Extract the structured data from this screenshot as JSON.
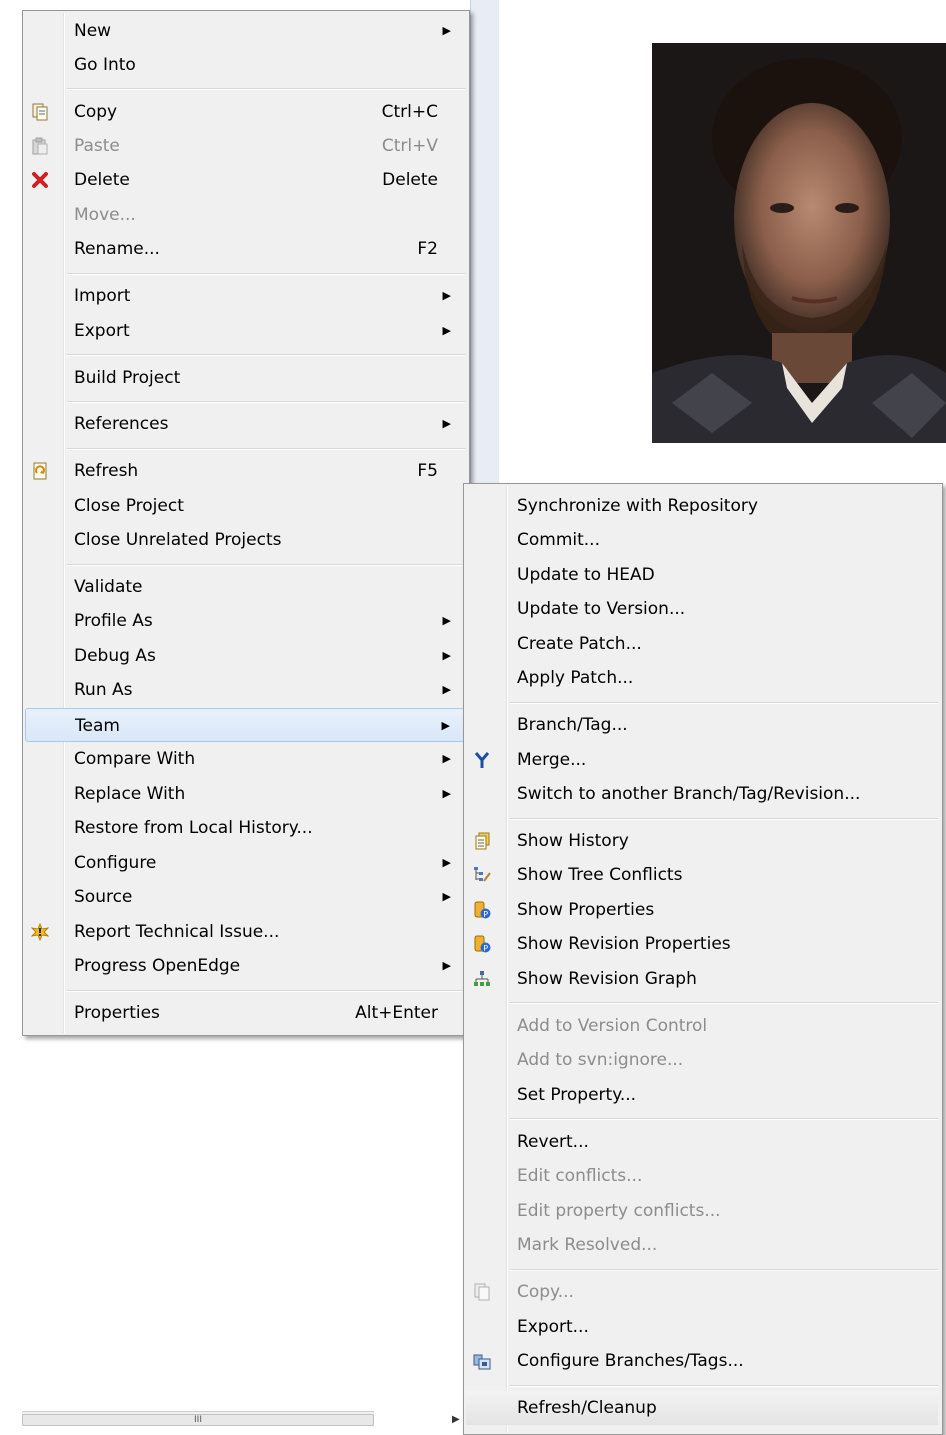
{
  "main_menu": {
    "items": [
      {
        "label": "New",
        "shortcut": "",
        "submenu": true,
        "disabled": false,
        "icon": ""
      },
      {
        "label": "Go Into",
        "shortcut": "",
        "submenu": false,
        "disabled": false,
        "icon": ""
      },
      {
        "label": "Copy",
        "shortcut": "Ctrl+C",
        "submenu": false,
        "disabled": false,
        "icon": "copy-icon"
      },
      {
        "label": "Paste",
        "shortcut": "Ctrl+V",
        "submenu": false,
        "disabled": true,
        "icon": "paste-icon"
      },
      {
        "label": "Delete",
        "shortcut": "Delete",
        "submenu": false,
        "disabled": false,
        "icon": "delete-icon"
      },
      {
        "label": "Move...",
        "shortcut": "",
        "submenu": false,
        "disabled": true,
        "icon": ""
      },
      {
        "label": "Rename...",
        "shortcut": "F2",
        "submenu": false,
        "disabled": false,
        "icon": ""
      },
      {
        "label": "Import",
        "shortcut": "",
        "submenu": true,
        "disabled": false,
        "icon": ""
      },
      {
        "label": "Export",
        "shortcut": "",
        "submenu": true,
        "disabled": false,
        "icon": ""
      },
      {
        "label": "Build Project",
        "shortcut": "",
        "submenu": false,
        "disabled": false,
        "icon": ""
      },
      {
        "label": "References",
        "shortcut": "",
        "submenu": true,
        "disabled": false,
        "icon": ""
      },
      {
        "label": "Refresh",
        "shortcut": "F5",
        "submenu": false,
        "disabled": false,
        "icon": "refresh-icon"
      },
      {
        "label": "Close Project",
        "shortcut": "",
        "submenu": false,
        "disabled": false,
        "icon": ""
      },
      {
        "label": "Close Unrelated Projects",
        "shortcut": "",
        "submenu": false,
        "disabled": false,
        "icon": ""
      },
      {
        "label": "Validate",
        "shortcut": "",
        "submenu": false,
        "disabled": false,
        "icon": ""
      },
      {
        "label": "Profile As",
        "shortcut": "",
        "submenu": true,
        "disabled": false,
        "icon": ""
      },
      {
        "label": "Debug As",
        "shortcut": "",
        "submenu": true,
        "disabled": false,
        "icon": ""
      },
      {
        "label": "Run As",
        "shortcut": "",
        "submenu": true,
        "disabled": false,
        "icon": ""
      },
      {
        "label": "Team",
        "shortcut": "",
        "submenu": true,
        "disabled": false,
        "icon": "",
        "selected": true
      },
      {
        "label": "Compare With",
        "shortcut": "",
        "submenu": true,
        "disabled": false,
        "icon": ""
      },
      {
        "label": "Replace With",
        "shortcut": "",
        "submenu": true,
        "disabled": false,
        "icon": ""
      },
      {
        "label": "Restore from Local History...",
        "shortcut": "",
        "submenu": false,
        "disabled": false,
        "icon": ""
      },
      {
        "label": "Configure",
        "shortcut": "",
        "submenu": true,
        "disabled": false,
        "icon": ""
      },
      {
        "label": "Source",
        "shortcut": "",
        "submenu": true,
        "disabled": false,
        "icon": ""
      },
      {
        "label": "Report Technical Issue...",
        "shortcut": "",
        "submenu": false,
        "disabled": false,
        "icon": "report-issue-icon"
      },
      {
        "label": "Progress OpenEdge",
        "shortcut": "",
        "submenu": true,
        "disabled": false,
        "icon": ""
      },
      {
        "label": "Properties",
        "shortcut": "Alt+Enter",
        "submenu": false,
        "disabled": false,
        "icon": ""
      }
    ],
    "submenu_arrow": "▶"
  },
  "team_menu": {
    "items": [
      {
        "label": "Synchronize with Repository",
        "disabled": false,
        "icon": ""
      },
      {
        "label": "Commit...",
        "disabled": false,
        "icon": ""
      },
      {
        "label": "Update to HEAD",
        "disabled": false,
        "icon": ""
      },
      {
        "label": "Update to Version...",
        "disabled": false,
        "icon": ""
      },
      {
        "label": "Create Patch...",
        "disabled": false,
        "icon": ""
      },
      {
        "label": "Apply Patch...",
        "disabled": false,
        "icon": ""
      },
      {
        "label": "Branch/Tag...",
        "disabled": false,
        "icon": ""
      },
      {
        "label": "Merge...",
        "disabled": false,
        "icon": "merge-icon"
      },
      {
        "label": "Switch to another Branch/Tag/Revision...",
        "disabled": false,
        "icon": ""
      },
      {
        "label": "Show History",
        "disabled": false,
        "icon": "history-icon"
      },
      {
        "label": "Show Tree Conflicts",
        "disabled": false,
        "icon": "tree-conflicts-icon"
      },
      {
        "label": "Show Properties",
        "disabled": false,
        "icon": "properties-icon"
      },
      {
        "label": "Show Revision Properties",
        "disabled": false,
        "icon": "revision-properties-icon"
      },
      {
        "label": "Show Revision Graph",
        "disabled": false,
        "icon": "revision-graph-icon"
      },
      {
        "label": "Add to Version Control",
        "disabled": true,
        "icon": ""
      },
      {
        "label": "Add to svn:ignore...",
        "disabled": true,
        "icon": ""
      },
      {
        "label": "Set Property...",
        "disabled": false,
        "icon": ""
      },
      {
        "label": "Revert...",
        "disabled": false,
        "icon": ""
      },
      {
        "label": "Edit conflicts...",
        "disabled": true,
        "icon": ""
      },
      {
        "label": "Edit property conflicts...",
        "disabled": true,
        "icon": ""
      },
      {
        "label": "Mark Resolved...",
        "disabled": true,
        "icon": ""
      },
      {
        "label": "Copy...",
        "disabled": true,
        "icon": "copy-icon"
      },
      {
        "label": "Export...",
        "disabled": false,
        "icon": ""
      },
      {
        "label": "Configure Branches/Tags...",
        "disabled": false,
        "icon": "configure-branches-icon"
      },
      {
        "label": "Refresh/Cleanup",
        "disabled": false,
        "icon": "",
        "hover": true
      }
    ]
  },
  "scrollbar": {
    "thumb_grip": "III",
    "arrow": "▶"
  },
  "colors": {
    "menu_bg": "#f0f0f0",
    "disabled_text": "#8c8c8c",
    "selected_bg": "#dce8f8",
    "delete_red": "#d02020",
    "merge_blue": "#1a4fa8"
  }
}
